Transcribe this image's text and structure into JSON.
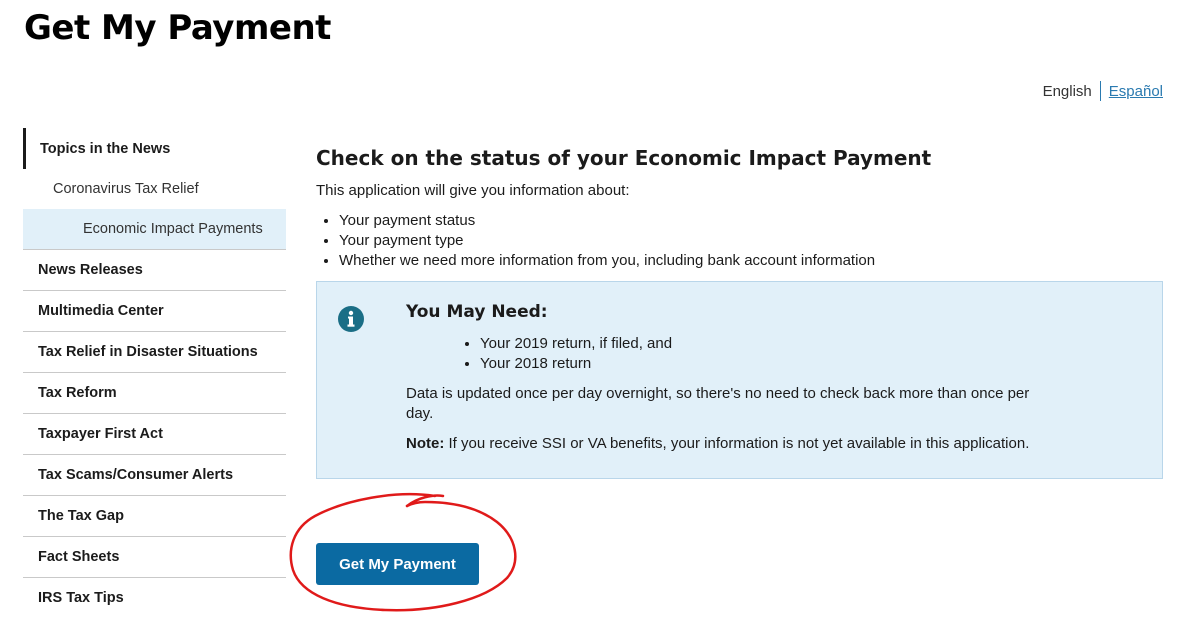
{
  "page": {
    "title": "Get My Payment"
  },
  "language": {
    "current": "English",
    "alternate": "Español"
  },
  "sidebar": {
    "top": "Topics in the News",
    "sub": "Coronavirus Tax Relief",
    "sub2": "Economic Impact Payments",
    "items": [
      "News Releases",
      "Multimedia Center",
      "Tax Relief in Disaster Situations",
      "Tax Reform",
      "Taxpayer First Act",
      "Tax Scams/Consumer Alerts",
      "The Tax Gap",
      "Fact Sheets",
      "IRS Tax Tips"
    ]
  },
  "main": {
    "heading": "Check on the status of your Economic Impact Payment",
    "intro": "This application will give you information about:",
    "list": [
      "Your payment status",
      "Your payment type",
      "Whether we need more information from you, including bank account information"
    ]
  },
  "alert": {
    "icon": "info-icon",
    "title": "You May Need:",
    "list": [
      "Your 2019 return, if filed, and",
      "Your 2018 return"
    ],
    "text": "Data is updated once per day overnight, so there's no need to check back more than once per day.",
    "note_label": "Note:",
    "note_text": " If you receive SSI or VA benefits, your information is not yet available in this application."
  },
  "button": {
    "label": "Get My Payment"
  },
  "colors": {
    "accent": "#0b6aa2",
    "alert_bg": "#e1f0f9",
    "info_icon": "#1a6e86",
    "annotation": "#e01a1a"
  }
}
